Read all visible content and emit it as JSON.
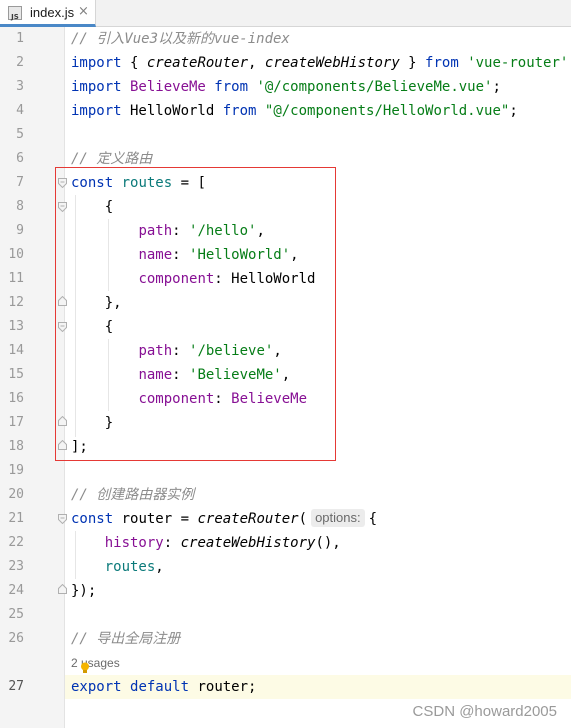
{
  "editor": {
    "tab": {
      "icon_text": "JS",
      "title": "index.js",
      "close_glyph": "×"
    },
    "line_numbers": [
      "1",
      "2",
      "3",
      "4",
      "5",
      "6",
      "7",
      "8",
      "9",
      "10",
      "11",
      "12",
      "13",
      "14",
      "15",
      "16",
      "17",
      "18",
      "19",
      "20",
      "21",
      "22",
      "23",
      "24",
      "25",
      "26",
      "27"
    ],
    "current_line": "27",
    "code": {
      "l1_comment": "// 引入Vue3以及新的vue-index",
      "l2": {
        "import": "import",
        "open": " { ",
        "createRouter": "createRouter",
        "comma": ", ",
        "createWebHistory": "createWebHistory",
        "close": " } ",
        "from": "from",
        "space": " ",
        "source": "'vue-router'",
        "semi": ";"
      },
      "l3": {
        "import": "import",
        "name": " BelieveMe ",
        "from": "from",
        "space": " ",
        "source": "'@/components/BelieveMe.vue'",
        "semi": ";"
      },
      "l4": {
        "import": "import",
        "name": " HelloWorld ",
        "from": "from",
        "space": " ",
        "source": "\"@/components/HelloWorld.vue\"",
        "semi": ";"
      },
      "l6_comment": "// 定义路由",
      "l7": {
        "const": "const",
        "space": " ",
        "name": "routes",
        "rest": " = ["
      },
      "l8": "    {",
      "l9": {
        "indent": "        ",
        "key": "path",
        "colon": ": ",
        "value": "'/hello'",
        "end": ","
      },
      "l10": {
        "indent": "        ",
        "key": "name",
        "colon": ": ",
        "value": "'HelloWorld'",
        "end": ","
      },
      "l11": {
        "indent": "        ",
        "key": "component",
        "colon": ": ",
        "value": "HelloWorld"
      },
      "l12": "    },",
      "l13": "    {",
      "l14": {
        "indent": "        ",
        "key": "path",
        "colon": ": ",
        "value": "'/believe'",
        "end": ","
      },
      "l15": {
        "indent": "        ",
        "key": "name",
        "colon": ": ",
        "value": "'BelieveMe'",
        "end": ","
      },
      "l16": {
        "indent": "        ",
        "key": "component",
        "colon": ": ",
        "value": "BelieveMe"
      },
      "l17": "    }",
      "l18": "];",
      "l20_comment": "// 创建路由器实例",
      "l21": {
        "const": "const",
        "space": " ",
        "name": "router",
        "eq": " = ",
        "call": "createRouter",
        "paren": "(",
        "hint": "options:",
        "brace": "{"
      },
      "l22": {
        "indent": "    ",
        "key": "history",
        "colon": ": ",
        "call": "createWebHistory",
        "rest": "(),"
      },
      "l23": {
        "indent": "    ",
        "value": "routes",
        "end": ","
      },
      "l24": "});",
      "l26_comment": "// 导出全局注册",
      "usages": "2 usages",
      "l27": {
        "export": "export",
        "space": " ",
        "default": "default",
        "rest": " router;"
      }
    }
  },
  "watermark": "CSDN @howard2005",
  "colors": {
    "keyword": "#0033b3",
    "string": "#067d17",
    "comment": "#8c8c8c",
    "property": "#871094",
    "highlight_box": "#e53935",
    "current_line_bg": "#fdfbe5"
  }
}
